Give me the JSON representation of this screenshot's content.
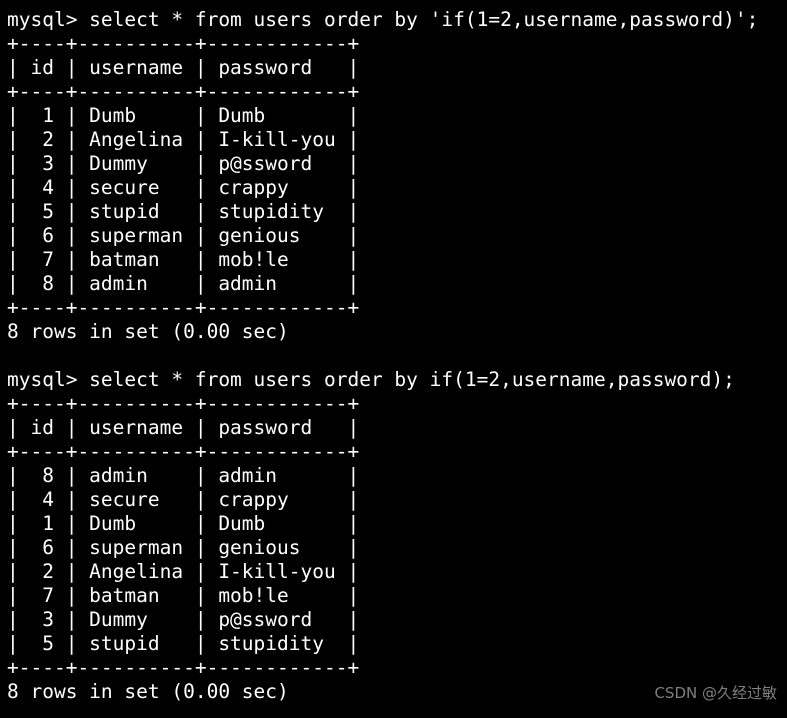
{
  "terminal": {
    "background_color": "#000000",
    "text_color": "#ffffff",
    "watermark": "CSDN @久经过敏",
    "watermark_color": "#8a8a8a",
    "lines": [
      "mysql> select * from users order by 'if(1=2,username,password)';",
      "+----+----------+------------+",
      "| id | username | password   |",
      "+----+----------+------------+",
      "|  1 | Dumb     | Dumb       |",
      "|  2 | Angelina | I-kill-you |",
      "|  3 | Dummy    | p@ssword   |",
      "|  4 | secure   | crappy     |",
      "|  5 | stupid   | stupidity  |",
      "|  6 | superman | genious    |",
      "|  7 | batman   | mob!le     |",
      "|  8 | admin    | admin      |",
      "+----+----------+------------+",
      "8 rows in set (0.00 sec)",
      "",
      "mysql> select * from users order by if(1=2,username,password);",
      "+----+----------+------------+",
      "| id | username | password   |",
      "+----+----------+------------+",
      "|  8 | admin    | admin      |",
      "|  4 | secure   | crappy     |",
      "|  1 | Dumb     | Dumb       |",
      "|  6 | superman | genious    |",
      "|  2 | Angelina | I-kill-you |",
      "|  7 | batman   | mob!le     |",
      "|  3 | Dummy    | p@ssword   |",
      "|  5 | stupid   | stupidity  |",
      "+----+----------+------------+",
      "8 rows in set (0.00 sec)"
    ],
    "queries": [
      {
        "prompt": "mysql>",
        "sql": "select * from users order by 'if(1=2,username,password)';",
        "result_status": "8 rows in set (0.00 sec)",
        "columns": [
          "id",
          "username",
          "password"
        ],
        "rows": [
          [
            "1",
            "Dumb",
            "Dumb"
          ],
          [
            "2",
            "Angelina",
            "I-kill-you"
          ],
          [
            "3",
            "Dummy",
            "p@ssword"
          ],
          [
            "4",
            "secure",
            "crappy"
          ],
          [
            "5",
            "stupid",
            "stupidity"
          ],
          [
            "6",
            "superman",
            "genious"
          ],
          [
            "7",
            "batman",
            "mob!le"
          ],
          [
            "8",
            "admin",
            "admin"
          ]
        ]
      },
      {
        "prompt": "mysql>",
        "sql": "select * from users order by if(1=2,username,password);",
        "result_status": "8 rows in set (0.00 sec)",
        "columns": [
          "id",
          "username",
          "password"
        ],
        "rows": [
          [
            "8",
            "admin",
            "admin"
          ],
          [
            "4",
            "secure",
            "crappy"
          ],
          [
            "1",
            "Dumb",
            "Dumb"
          ],
          [
            "6",
            "superman",
            "genious"
          ],
          [
            "2",
            "Angelina",
            "I-kill-you"
          ],
          [
            "7",
            "batman",
            "mob!le"
          ],
          [
            "3",
            "Dummy",
            "p@ssword"
          ],
          [
            "5",
            "stupid",
            "stupidity"
          ]
        ]
      }
    ]
  }
}
